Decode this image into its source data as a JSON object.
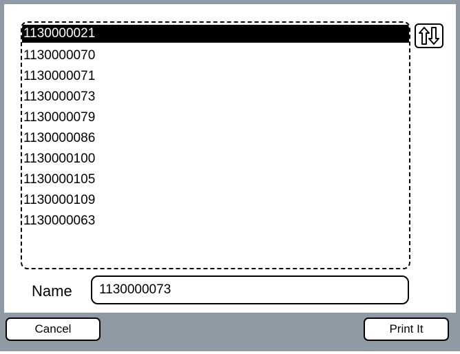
{
  "list": {
    "items": [
      "1130000021",
      "1130000070",
      "1130000071",
      "1130000073",
      "1130000079",
      "1130000086",
      "1130000100",
      "1130000105",
      "1130000109",
      "1130000063"
    ],
    "selected_index": 0
  },
  "sort_button": {
    "icon": "up-down-arrows-icon"
  },
  "name_field": {
    "label": "Name",
    "value": "1130000073"
  },
  "buttons": {
    "cancel_label": "Cancel",
    "print_label": "Print It"
  },
  "colors": {
    "frame": "#8f9aa4",
    "selection": "#000000"
  }
}
